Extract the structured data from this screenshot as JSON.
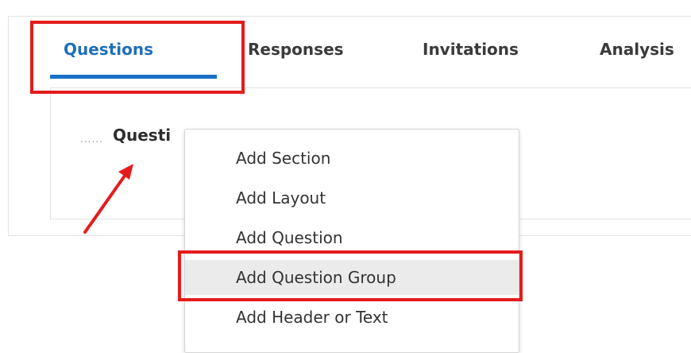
{
  "tabs": [
    {
      "label": "Questions",
      "active": true
    },
    {
      "label": "Responses",
      "active": false
    },
    {
      "label": "Invitations",
      "active": false
    },
    {
      "label": "Analysis",
      "active": false
    }
  ],
  "tree": {
    "dots": "......",
    "label": "Questi"
  },
  "context_menu": {
    "items": [
      {
        "label": "Add Section"
      },
      {
        "label": "Add Layout"
      },
      {
        "label": "Add Question"
      },
      {
        "label": "Add Question Group",
        "highlighted": true
      },
      {
        "label": "Add Header or Text"
      }
    ]
  },
  "colors": {
    "accent": "#1a6fc6",
    "annotation": "#e41c1c",
    "highlight_bg": "#ebebeb"
  }
}
